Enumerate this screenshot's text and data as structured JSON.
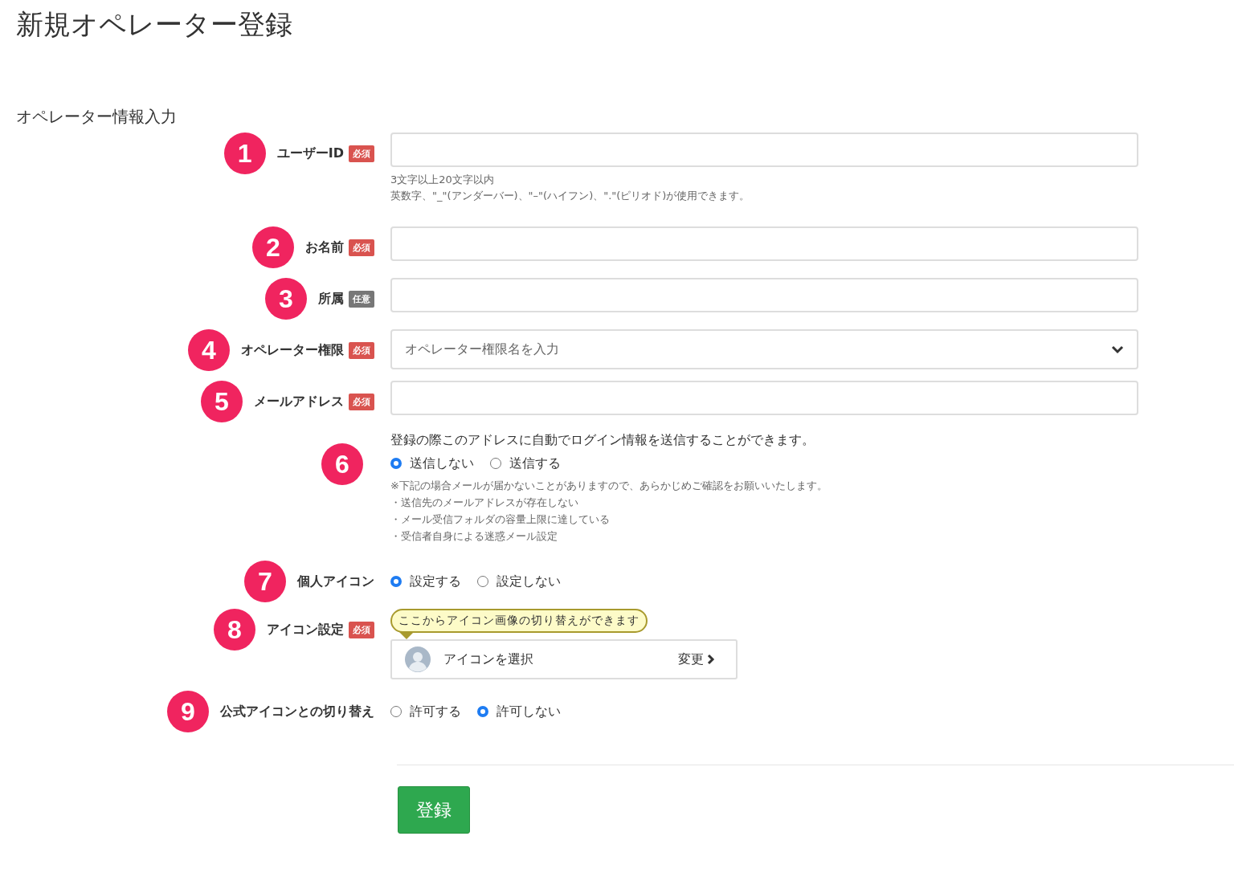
{
  "title": "新規オペレーター登録",
  "section": "オペレーター情報入力",
  "fields": [
    {
      "kind": "text",
      "marker": "1",
      "label": "ユーザーID",
      "badge": {
        "text": "必須",
        "kind": "required"
      },
      "hints": [
        "3文字以上20文字以内",
        "英数字、\"_\"(アンダーバー)、\"–\"(ハイフン)、\".\"(ピリオド)が使用できます。"
      ]
    },
    {
      "kind": "text",
      "marker": "2",
      "label": "お名前",
      "badge": {
        "text": "必須",
        "kind": "required"
      }
    },
    {
      "kind": "text",
      "marker": "3",
      "label": "所属",
      "badge": {
        "text": "任意",
        "kind": "optional"
      }
    },
    {
      "kind": "select",
      "marker": "4",
      "label": "オペレーター権限",
      "badge": {
        "text": "必須",
        "kind": "required"
      },
      "placeholder": "オペレーター権限名を入力"
    },
    {
      "kind": "text",
      "marker": "5",
      "label": "メールアドレス",
      "badge": {
        "text": "必須",
        "kind": "required"
      }
    },
    {
      "kind": "radio",
      "marker": "6",
      "intro": "登録の際このアドレスに自動でログイン情報を送信することができます。",
      "options": [
        {
          "label": "送信しない",
          "selected": true
        },
        {
          "label": "送信する",
          "selected": false
        }
      ],
      "notes": [
        "※下記の場合メールが届かないことがありますので、あらかじめご確認をお願いいたします。",
        "・送信先のメールアドレスが存在しない",
        "・メール受信フォルダの容量上限に達している",
        "・受信者自身による迷惑メール設定"
      ]
    },
    {
      "kind": "radio",
      "marker": "7",
      "label": "個人アイコン",
      "options": [
        {
          "label": "設定する",
          "selected": true
        },
        {
          "label": "設定しない",
          "selected": false
        }
      ]
    },
    {
      "kind": "icon",
      "marker": "8",
      "label": "アイコン設定",
      "badge": {
        "text": "必須",
        "kind": "required"
      },
      "tooltip": "ここからアイコン画像の切り替えができます",
      "value": "アイコンを選択",
      "action": "変更"
    },
    {
      "kind": "radio",
      "marker": "9",
      "label": "公式アイコンとの切り替え",
      "options": [
        {
          "label": "許可する",
          "selected": false
        },
        {
          "label": "許可しない",
          "selected": true
        }
      ]
    }
  ],
  "submit": "登録"
}
